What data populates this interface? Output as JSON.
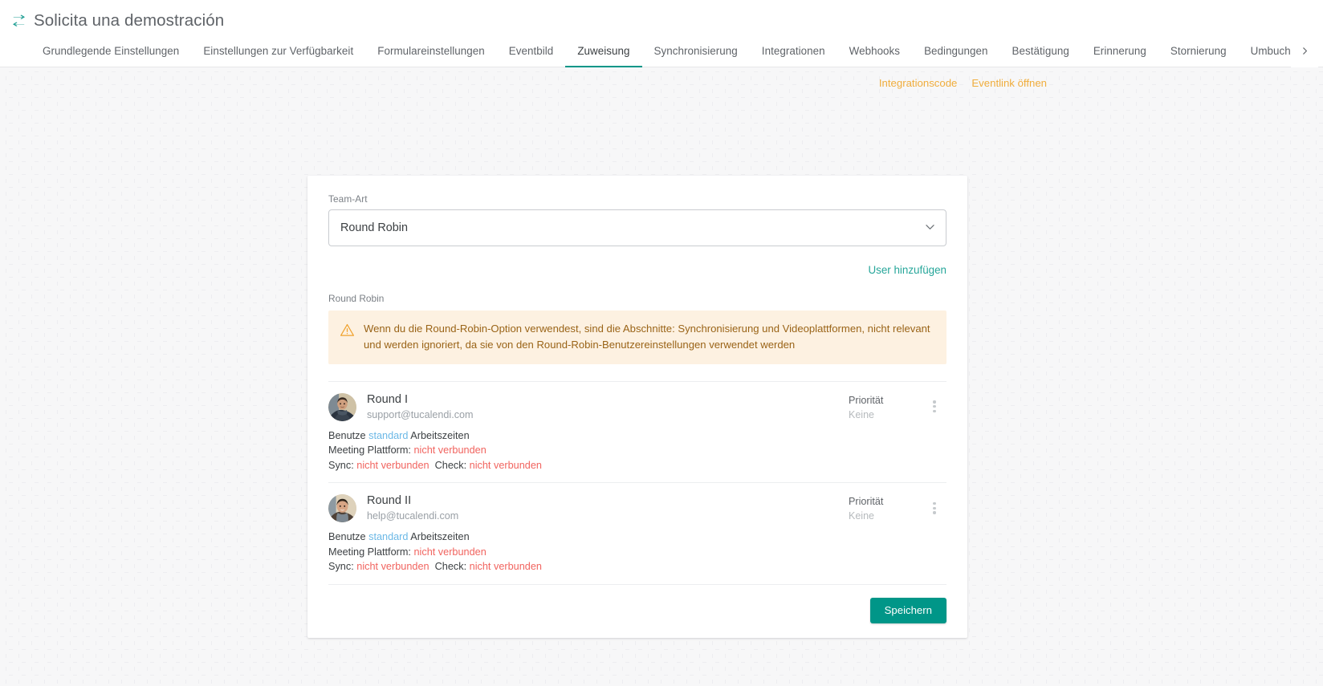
{
  "header": {
    "icon": "exchange-arrows-icon",
    "title": "Solicita una demostración"
  },
  "tabs": {
    "items": [
      {
        "label": "Grundlegende Einstellungen",
        "active": false
      },
      {
        "label": "Einstellungen zur Verfügbarkeit",
        "active": false
      },
      {
        "label": "Formulareinstellungen",
        "active": false
      },
      {
        "label": "Eventbild",
        "active": false
      },
      {
        "label": "Zuweisung",
        "active": true
      },
      {
        "label": "Synchronisierung",
        "active": false
      },
      {
        "label": "Integrationen",
        "active": false
      },
      {
        "label": "Webhooks",
        "active": false
      },
      {
        "label": "Bedingungen",
        "active": false
      },
      {
        "label": "Bestätigung",
        "active": false
      },
      {
        "label": "Erinnerung",
        "active": false
      },
      {
        "label": "Stornierung",
        "active": false
      },
      {
        "label": "Umbuchung",
        "active": false
      }
    ],
    "scroll_right_icon": "chevron-right-icon"
  },
  "quicklinks": [
    {
      "label": "Integrationscode"
    },
    {
      "label": "Eventlink öffnen"
    }
  ],
  "form": {
    "team_type_label": "Team-Art",
    "team_type_value": "Round Robin",
    "dropdown_icon": "chevron-down-icon",
    "add_user_label": "User hinzufügen",
    "section_label": "Round Robin"
  },
  "warning": {
    "icon": "warning-triangle-icon",
    "text": "Wenn du die Round-Robin-Option verwendest, sind die Abschnitte: Synchronisierung und Videoplattformen, nicht relevant und werden ignoriert, da sie von den Round-Robin-Benutzereinstellungen verwendet werden"
  },
  "users": [
    {
      "name": "Round I",
      "email": "support@tucalendi.com",
      "working_hours_prefix": "Benutze",
      "working_hours_link": "standard",
      "working_hours_suffix": "Arbeitszeiten",
      "meeting_platform_label": "Meeting Plattform:",
      "meeting_platform_value": "nicht verbunden",
      "sync_label": "Sync:",
      "sync_value": "nicht verbunden",
      "check_label": "Check:",
      "check_value": "nicht verbunden",
      "priority_label": "Priorität",
      "priority_value": "Keine",
      "menu_icon": "kebab-menu-icon",
      "avatar": "user-photo-avatar"
    },
    {
      "name": "Round II",
      "email": "help@tucalendi.com",
      "working_hours_prefix": "Benutze",
      "working_hours_link": "standard",
      "working_hours_suffix": "Arbeitszeiten",
      "meeting_platform_label": "Meeting Plattform:",
      "meeting_platform_value": "nicht verbunden",
      "sync_label": "Sync:",
      "sync_value": "nicht verbunden",
      "check_label": "Check:",
      "check_value": "nicht verbunden",
      "priority_label": "Priorität",
      "priority_value": "Keine",
      "menu_icon": "kebab-menu-icon",
      "avatar": "user-photo-avatar"
    }
  ],
  "footer": {
    "save_label": "Speichern"
  },
  "colors": {
    "accent_teal": "#009688",
    "link_teal": "#26a69a",
    "quicklink_amber": "#f0ad3c",
    "warning_bg": "#fdf1e1",
    "warning_text": "#9a6418",
    "status_red": "#f1645f",
    "status_blue": "#6bb8e6"
  }
}
